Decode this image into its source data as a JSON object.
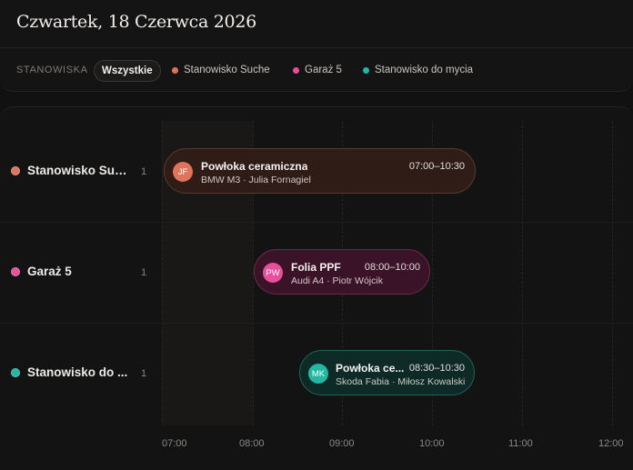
{
  "header": {
    "title": "Czwartek, 18 Czerwca 2026"
  },
  "filters": {
    "label": "STANOWISKA",
    "all": "Wszystkie",
    "items": [
      {
        "label": "Stanowisko Suche",
        "color": "#e0745a"
      },
      {
        "label": "Garaż 5",
        "color": "#e94f9a"
      },
      {
        "label": "Stanowisko do mycia",
        "color": "#22b8a3"
      }
    ]
  },
  "rows": [
    {
      "name": "Stanowisko Suche",
      "count": "1",
      "color": "#e0745a"
    },
    {
      "name": "Garaż 5",
      "count": "1",
      "color": "#e94f9a"
    },
    {
      "name": "Stanowisko do mycia",
      "display_name": "Stanowisko do ...",
      "count": "1",
      "color": "#22b8a3"
    }
  ],
  "events": [
    {
      "initials": "JF",
      "title": "Powłoka ceramiczna",
      "time": "07:00–10:30",
      "subtitle": "BMW M3 · Julia Fornagiel",
      "color": "#e0745a"
    },
    {
      "initials": "PW",
      "title": "Folia PPF",
      "time": "08:00–10:00",
      "subtitle": "Audi A4 · Piotr Wójcik",
      "color": "#e94f9a"
    },
    {
      "initials": "MK",
      "title": "Powłoka ce...",
      "time": "08:30–10:30",
      "subtitle": "Skoda Fabia · Miłosz Kowalski",
      "color": "#22b8a3"
    }
  ],
  "timeline": {
    "ticks": [
      "07:00",
      "08:00",
      "09:00",
      "10:00",
      "11:00",
      "12:00"
    ]
  }
}
